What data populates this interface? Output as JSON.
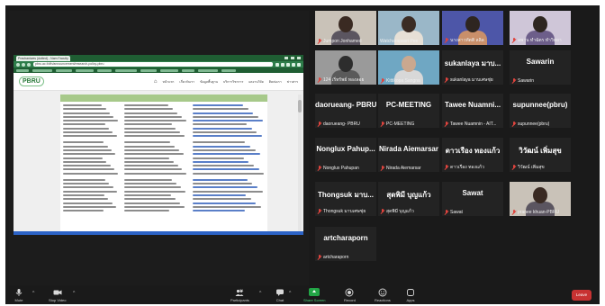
{
  "shared_screen": {
    "browser": {
      "tab_title": "Prachaniwes (dotted) - Nam Faculty",
      "url": "pbru.ac.th/th/announcement/research-policy-pbru",
      "site_logo": "PBRU",
      "menu_items": [
        "หน้าแรก",
        "เกี่ยวกับเรา",
        "ข้อมูลพื้นฐาน",
        "บริการวิชาการ",
        "ผลงานวิจัย",
        "ติดต่อเรา",
        "ข่าวสาร"
      ]
    }
  },
  "participants": [
    {
      "big": "",
      "name": "Jumpon Jonhamed",
      "video": true,
      "muted": true,
      "active": false
    },
    {
      "big": "",
      "name": "Watcharapasri Pee",
      "video": true,
      "muted": false,
      "active": true
    },
    {
      "big": "",
      "name": "นางสาวทัตติ ลลิล",
      "video": true,
      "muted": true,
      "active": false
    },
    {
      "big": "",
      "name": "อพาน ทำฉัตร ทำวิทยา",
      "video": true,
      "muted": true,
      "active": false
    },
    {
      "big": "",
      "name": "124 เริ่ทรัพย์ ทองลอย",
      "video": true,
      "muted": true,
      "active": false
    },
    {
      "big": "",
      "name": "Kittikopa Sangna",
      "video": true,
      "muted": true,
      "active": false
    },
    {
      "big": "sukanlaya มาบ...",
      "name": "sukanlaya มาบเศษชุ่ย",
      "video": false,
      "muted": true,
      "active": false
    },
    {
      "big": "Sawarin",
      "name": "Sawarin",
      "video": false,
      "muted": true,
      "active": false
    },
    {
      "big": "daorueang- PBRU",
      "name": "daorueang- PBRU",
      "video": false,
      "muted": true,
      "active": false
    },
    {
      "big": "PC-MEETING",
      "name": "PC-MEETING",
      "video": false,
      "muted": true,
      "active": false
    },
    {
      "big": "Tawee Nuamni...",
      "name": "Tawee Nuamnin - AIT...",
      "video": false,
      "muted": true,
      "active": false
    },
    {
      "big": "supunnee(pbru)",
      "name": "supunnee(pbru)",
      "video": false,
      "muted": true,
      "active": false
    },
    {
      "big": "Nonglux Pahup...",
      "name": "Nonglux Pahupan",
      "video": false,
      "muted": true,
      "active": false
    },
    {
      "big": "Nirada Aiemarsar",
      "name": "Nirada Aiemarsar",
      "video": false,
      "muted": true,
      "active": false
    },
    {
      "big": "ดาวเรือง ทองแก้ว",
      "name": "ดาวเรือง ทองแก้ว",
      "video": false,
      "muted": true,
      "active": false
    },
    {
      "big": "วิวัฒน์ เพิ่มสุข",
      "name": "วิวัฒน์ เพิ่มสุข",
      "video": false,
      "muted": true,
      "active": false
    },
    {
      "big": "Thongsuk มาบ...",
      "name": "Thongsuk มาบเศษชุ่ย",
      "video": false,
      "muted": true,
      "active": false
    },
    {
      "big": "สุดพิมี บุญแก้ว",
      "name": "สุดพิมี บุญแก้ว",
      "video": false,
      "muted": true,
      "active": false
    },
    {
      "big": "Sawat",
      "name": "Sawat",
      "video": false,
      "muted": true,
      "active": false
    },
    {
      "big": "",
      "name": "pranee khuan-PBRU",
      "video": true,
      "muted": true,
      "active": false
    },
    {
      "big": "artcharaporn",
      "name": "artcharaporn",
      "video": false,
      "muted": true,
      "active": false
    }
  ],
  "toolbar": {
    "mute": "Mute",
    "stop_video": "Stop Video",
    "participants": "Participants",
    "participants_count": "21",
    "chat": "Chat",
    "share_screen": "Share Screen",
    "record": "Record",
    "reactions": "Reactions",
    "apps": "Apps",
    "leave": "Leave"
  },
  "colors": {
    "active_speaker": "#f1d94b",
    "share_green": "#22a546",
    "leave_red": "#c83232",
    "muted_mic": "#e0443e"
  }
}
